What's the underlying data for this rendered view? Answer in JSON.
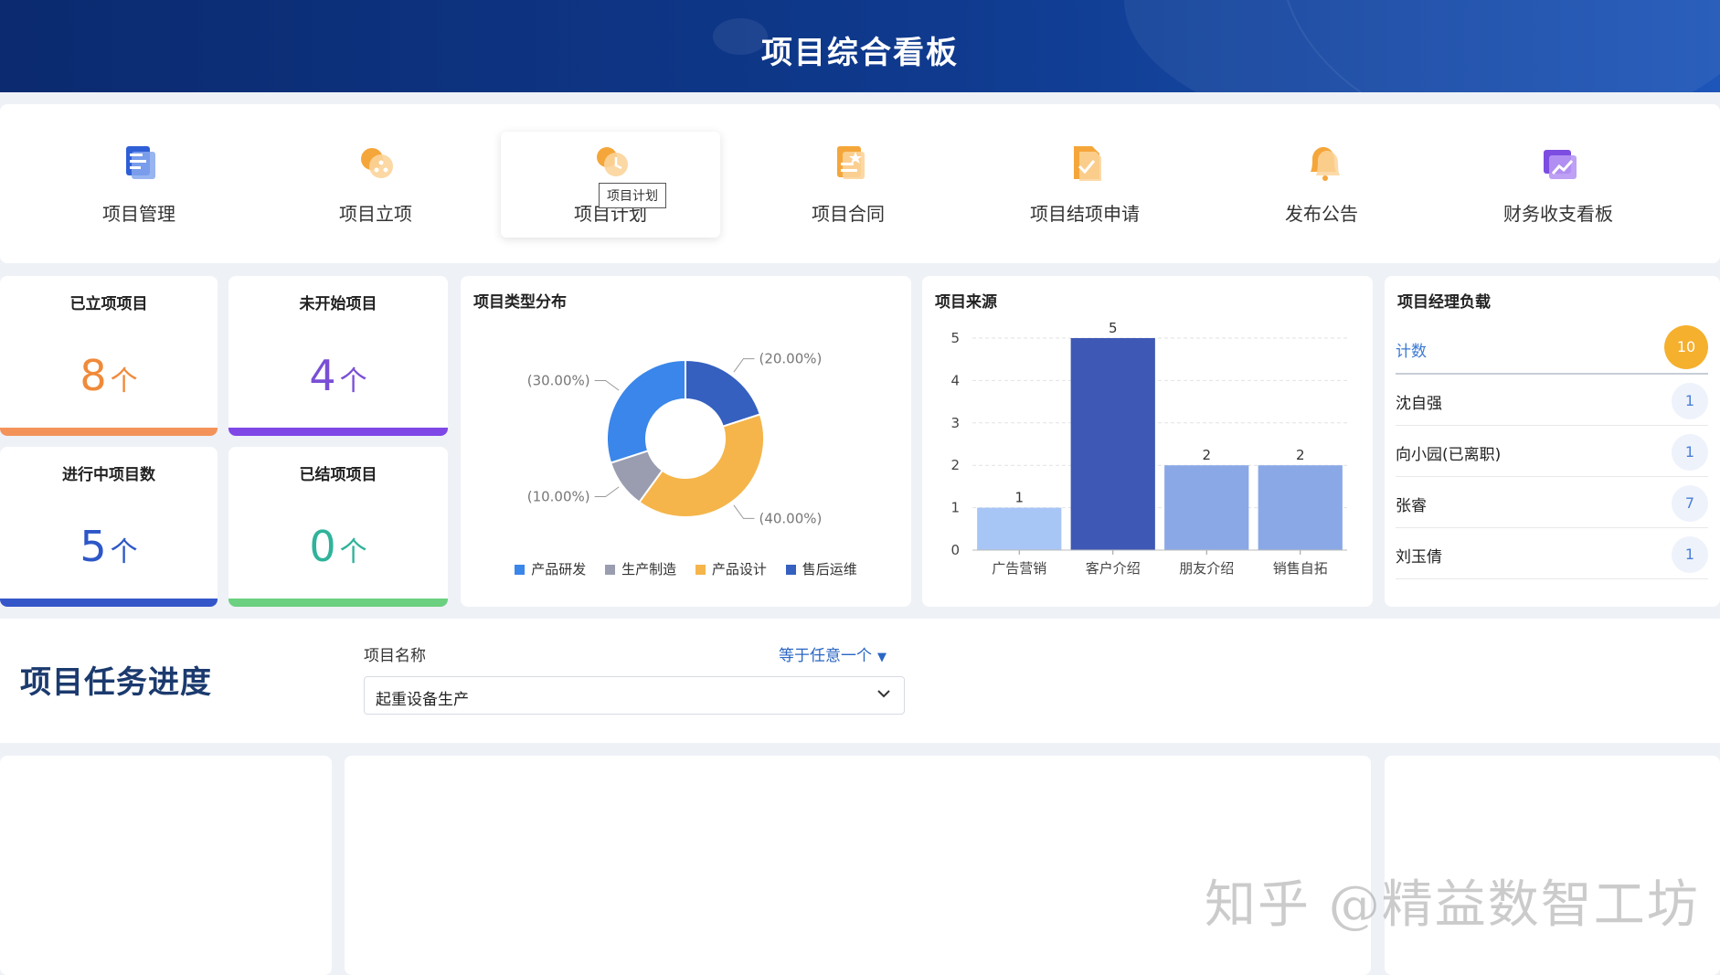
{
  "header": {
    "title": "项目综合看板"
  },
  "nav": {
    "items": [
      {
        "label": "项目管理",
        "icon": "project-manage-icon"
      },
      {
        "label": "项目立项",
        "icon": "project-setup-icon"
      },
      {
        "label": "项目计划",
        "icon": "project-plan-icon"
      },
      {
        "label": "项目合同",
        "icon": "contract-icon"
      },
      {
        "label": "项目结项申请",
        "icon": "closing-request-icon"
      },
      {
        "label": "发布公告",
        "icon": "announcement-bell-icon"
      },
      {
        "label": "财务收支看板",
        "icon": "finance-chart-icon"
      }
    ],
    "tooltip": "项目计划"
  },
  "stats": [
    {
      "title": "已立项项目",
      "value": "8",
      "unit": "个",
      "color": "#f08a3a"
    },
    {
      "title": "未开始项目",
      "value": "4",
      "unit": "个",
      "color": "#7a4fd6"
    },
    {
      "title": "进行中项目数",
      "value": "5",
      "unit": "个",
      "color": "#2d57c8"
    },
    {
      "title": "已结项项目",
      "value": "0",
      "unit": "个",
      "color": "#2fb39a"
    }
  ],
  "stat_bar_colors": [
    "#f3935a",
    "#7f47e6",
    "#3556c9",
    "#6bd07f"
  ],
  "type_panel": {
    "title": "项目类型分布"
  },
  "source_panel": {
    "title": "项目来源"
  },
  "manager_panel": {
    "title": "项目经理负载",
    "head": {
      "name": "计数",
      "count": "10"
    },
    "rows": [
      {
        "name": "沈自强",
        "count": "1"
      },
      {
        "name": "向小园(已离职)",
        "count": "1"
      },
      {
        "name": "张睿",
        "count": "7"
      },
      {
        "name": "刘玉倩",
        "count": "1"
      }
    ]
  },
  "task_section": {
    "title": "项目任务进度",
    "filter_label": "项目名称",
    "filter_op": "等于任意一个",
    "selected": "起重设备生产"
  },
  "watermark": "知乎 @精益数智工坊",
  "chart_data": [
    {
      "type": "pie",
      "donut": true,
      "categories": [
        "售后运维",
        "产品设计",
        "生产制造",
        "产品研发"
      ],
      "values": [
        20,
        40,
        10,
        30
      ],
      "labels": [
        "(20.00%)",
        "(40.00%)",
        "(10.00%)",
        "(30.00%)"
      ],
      "colors": [
        "#3560c0",
        "#f5b54b",
        "#9a9db0",
        "#3a86ea"
      ],
      "legend": [
        {
          "name": "产品研发",
          "color": "#3a86ea"
        },
        {
          "name": "生产制造",
          "color": "#9a9db0"
        },
        {
          "name": "产品设计",
          "color": "#f5b54b"
        },
        {
          "name": "售后运维",
          "color": "#3560c0"
        }
      ],
      "legend_position": "bottom"
    },
    {
      "type": "bar",
      "categories": [
        "广告营销",
        "客户介绍",
        "朋友介绍",
        "销售自拓"
      ],
      "values": [
        1,
        5,
        2,
        2
      ],
      "colors": [
        "#a8c6f5",
        "#3e58b5",
        "#8aa8e6",
        "#8aa8e6"
      ],
      "yticks": [
        0,
        1,
        2,
        3,
        4,
        5
      ],
      "ylim": [
        0,
        5
      ],
      "grid": true
    }
  ]
}
